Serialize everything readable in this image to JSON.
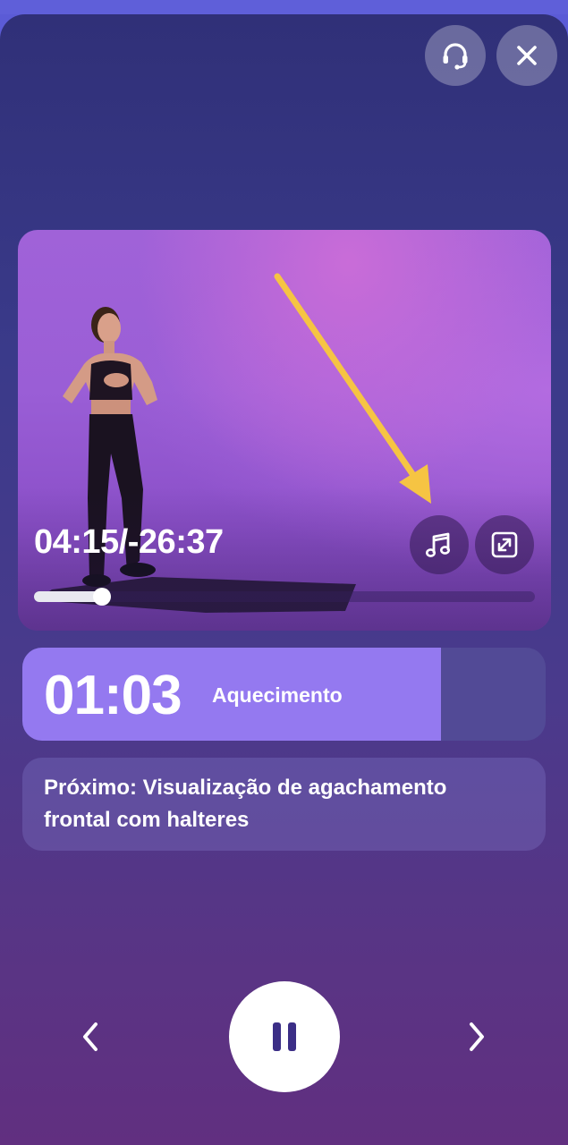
{
  "player": {
    "elapsed": "04:15",
    "separator": "/",
    "remaining": "-26:37",
    "progress_fraction": 0.135
  },
  "interval": {
    "countdown": "01:03",
    "label": "Aquecimento",
    "progress_fraction": 0.8
  },
  "next": {
    "text": "Próximo: Visualização de agachamento frontal com halteres"
  },
  "icons": {
    "support": "headset-icon",
    "close": "close-icon",
    "music": "music-note-icon",
    "expand": "expand-icon",
    "prev": "chevron-left-icon",
    "pause": "pause-icon",
    "next": "chevron-right-icon",
    "annotation": "yellow-arrow"
  },
  "colors": {
    "accent": "#9479f0",
    "arrow": "#f6c443",
    "pause_glyph": "#3b2e86"
  }
}
